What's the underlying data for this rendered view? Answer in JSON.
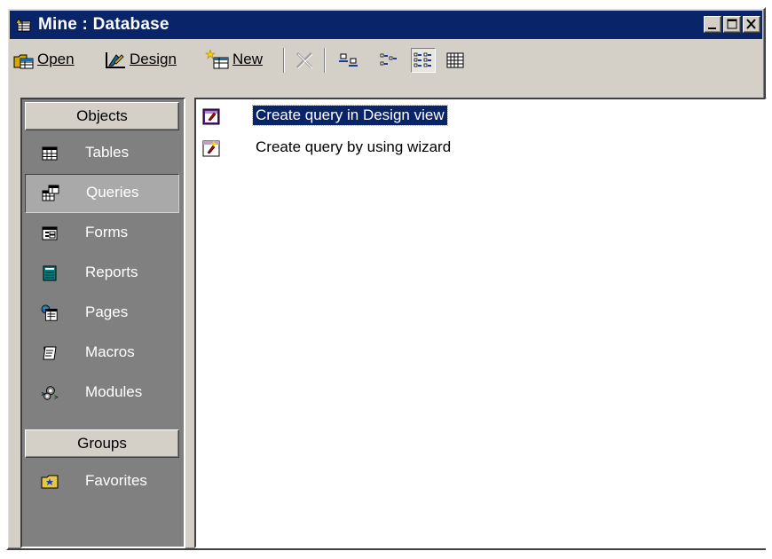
{
  "window": {
    "title": "Mine : Database"
  },
  "toolbar": {
    "open_label": "Open",
    "design_label": "Design",
    "new_label": "New",
    "view_buttons": [
      "large-icons-view-icon",
      "small-icons-view-icon",
      "list-view-icon",
      "details-view-icon"
    ]
  },
  "sidebar": {
    "objects_header": "Objects",
    "items": [
      {
        "label": "Tables",
        "icon": "table-icon"
      },
      {
        "label": "Queries",
        "icon": "query-icon"
      },
      {
        "label": "Forms",
        "icon": "form-icon"
      },
      {
        "label": "Reports",
        "icon": "report-icon"
      },
      {
        "label": "Pages",
        "icon": "page-icon"
      },
      {
        "label": "Macros",
        "icon": "macro-icon"
      },
      {
        "label": "Modules",
        "icon": "module-icon"
      }
    ],
    "selected": "Queries",
    "groups_header": "Groups",
    "groups": [
      {
        "label": "Favorites",
        "icon": "favorites-folder-icon"
      }
    ]
  },
  "content": {
    "items": [
      {
        "label": "Create query in Design view",
        "selected": true
      },
      {
        "label": "Create query by using wizard",
        "selected": false
      }
    ]
  },
  "colors": {
    "titlebar": "#0a246a",
    "face": "#d4d0c8",
    "sidebar": "#808080",
    "selection": "#0a246a"
  }
}
